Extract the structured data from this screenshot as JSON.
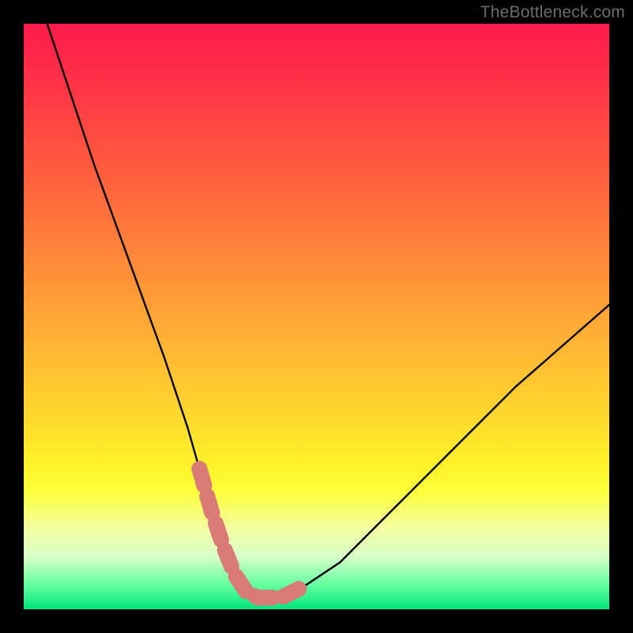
{
  "watermark": {
    "text": "TheBottleneck.com"
  },
  "chart_data": {
    "type": "line",
    "title": "",
    "xlabel": "",
    "ylabel": "",
    "xlim": [
      0,
      100
    ],
    "ylim": [
      0,
      100
    ],
    "grid": false,
    "legend": false,
    "annotations": [],
    "series": [
      {
        "name": "bottleneck-curve",
        "color": "#000000",
        "x": [
          4,
          8,
          12,
          16,
          20,
          24,
          28,
          30,
          32,
          34,
          36,
          38,
          40,
          44,
          48,
          54,
          60,
          68,
          76,
          84,
          92,
          100
        ],
        "y": [
          100,
          88,
          76,
          65,
          54,
          43,
          31,
          24,
          17,
          11,
          6,
          3,
          2,
          2,
          4,
          8,
          14,
          22,
          30,
          38,
          45,
          52
        ]
      },
      {
        "name": "optimal-range-marker",
        "color": "#d97a76",
        "x": [
          30,
          32,
          34,
          36,
          38,
          40,
          42,
          44,
          46,
          48
        ],
        "y": [
          24,
          17,
          11,
          6,
          3,
          2,
          2,
          2,
          3,
          4
        ]
      }
    ],
    "background_gradient": {
      "stops": [
        {
          "pos": 0.0,
          "color": "#ff1a4a"
        },
        {
          "pos": 0.3,
          "color": "#ff6a3c"
        },
        {
          "pos": 0.66,
          "color": "#ffd52e"
        },
        {
          "pos": 0.8,
          "color": "#fcff3a"
        },
        {
          "pos": 1.0,
          "color": "#00e57a"
        }
      ]
    }
  }
}
